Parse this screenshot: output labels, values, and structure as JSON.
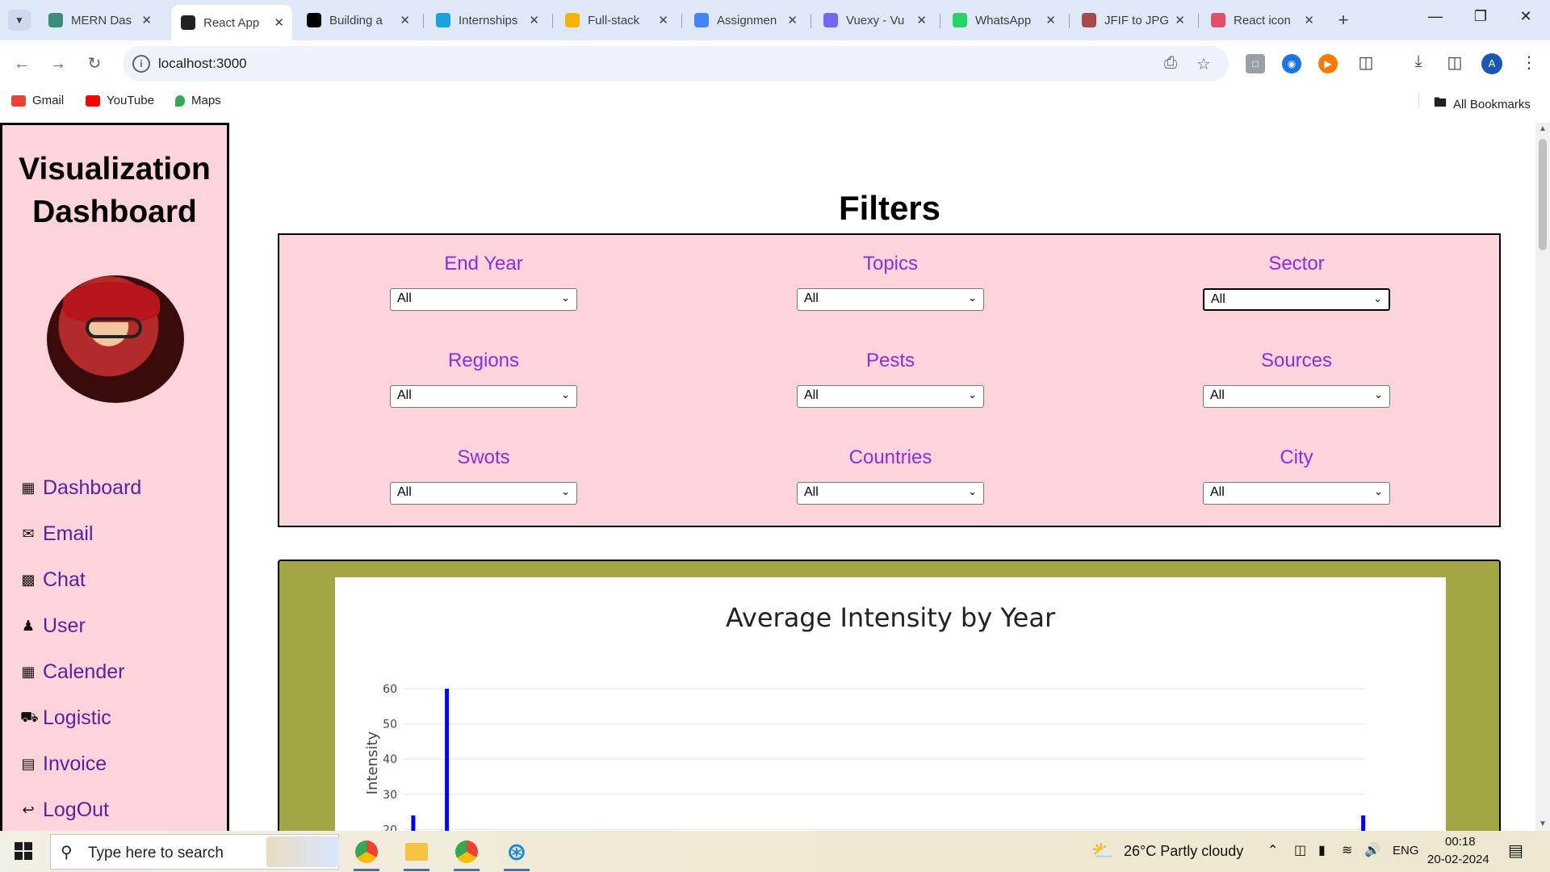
{
  "browser": {
    "tabs": [
      {
        "title": "MERN Das",
        "favicon_color": "#3b8c7a",
        "active": false
      },
      {
        "title": "React App",
        "favicon_color": "#222222",
        "active": true
      },
      {
        "title": "Building a",
        "favicon_color": "#000000",
        "active": false
      },
      {
        "title": "Internships",
        "favicon_color": "#1aa1e0",
        "active": false
      },
      {
        "title": "Full-stack",
        "favicon_color": "#f4b400",
        "active": false
      },
      {
        "title": "Assignmen",
        "favicon_color": "#4285f4",
        "active": false
      },
      {
        "title": "Vuexy - Vu",
        "favicon_color": "#7367f0",
        "active": false
      },
      {
        "title": "WhatsApp",
        "favicon_color": "#25d366",
        "active": false
      },
      {
        "title": "JFIF to JPG",
        "favicon_color": "#a84a4a",
        "active": false
      },
      {
        "title": "React icon",
        "favicon_color": "#e44d6a",
        "active": false
      }
    ],
    "url": "localhost:3000",
    "bookmarks": [
      {
        "label": "Gmail",
        "color": "#ea4335"
      },
      {
        "label": "YouTube",
        "color": "#ff0000"
      },
      {
        "label": "Maps",
        "color": "#34a853"
      }
    ],
    "all_bookmarks_label": "All Bookmarks",
    "profile_initial": "A"
  },
  "sidebar": {
    "title_line1": "Visualization",
    "title_line2": "Dashboard",
    "items": [
      {
        "label": "Dashboard",
        "icon": "grid-icon"
      },
      {
        "label": "Email",
        "icon": "envelope-icon"
      },
      {
        "label": "Chat",
        "icon": "chat-bubble-icon"
      },
      {
        "label": "User",
        "icon": "user-icon"
      },
      {
        "label": "Calender",
        "icon": "calendar-icon"
      },
      {
        "label": "Logistic",
        "icon": "truck-icon"
      },
      {
        "label": "Invoice",
        "icon": "invoice-icon"
      },
      {
        "label": "LogOut",
        "icon": "logout-icon"
      }
    ]
  },
  "filters": {
    "title": "Filters",
    "items": [
      {
        "label": "End Year",
        "value": "All"
      },
      {
        "label": "Topics",
        "value": "All"
      },
      {
        "label": "Sector",
        "value": "All"
      },
      {
        "label": "Regions",
        "value": "All"
      },
      {
        "label": "Pests",
        "value": "All"
      },
      {
        "label": "Sources",
        "value": "All"
      },
      {
        "label": "Swots",
        "value": "All"
      },
      {
        "label": "Countries",
        "value": "All"
      },
      {
        "label": "City",
        "value": "All"
      }
    ]
  },
  "chart_data": {
    "type": "bar",
    "title": "Average Intensity by Year",
    "xlabel": "",
    "ylabel": "Intensity",
    "yticks": [
      20,
      30,
      40,
      50,
      60
    ],
    "ylim_visible": [
      20,
      60
    ],
    "bar_color": "#0000ff",
    "grid": true,
    "bars": [
      {
        "x_frac": 0.01,
        "value": 24
      },
      {
        "x_frac": 0.045,
        "value": 60
      },
      {
        "x_frac": 0.998,
        "value": 24
      }
    ]
  },
  "taskbar": {
    "search_placeholder": "Type here to search",
    "weather": "26°C  Partly cloudy",
    "language": "ENG",
    "time": "00:18",
    "date": "20-02-2024"
  }
}
